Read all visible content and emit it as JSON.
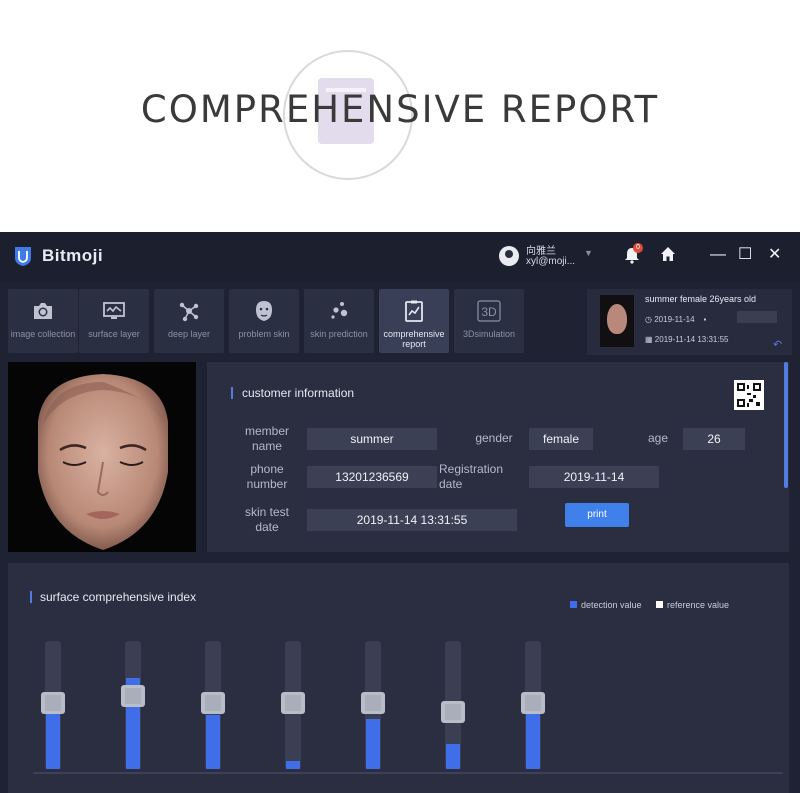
{
  "hero": {
    "title": "COMPREHENSIVE REPORT"
  },
  "app": {
    "title": "Bitmoji",
    "user": {
      "name": "向雅兰",
      "email": "xyl@moji...",
      "notifications": "0"
    },
    "window_controls": {
      "minimize": "—",
      "maximize": "☐",
      "close": "✕"
    }
  },
  "tabs": [
    {
      "label": "image collection",
      "icon": "camera-icon",
      "active": false
    },
    {
      "label": "surface layer",
      "icon": "monitor-wave-icon",
      "active": false
    },
    {
      "label": "deep layer",
      "icon": "molecule-icon",
      "active": false
    },
    {
      "label": "problem skin",
      "icon": "face-mask-icon",
      "active": false
    },
    {
      "label": "skin prediction",
      "icon": "dots-icon",
      "active": false
    },
    {
      "label": "comprehensive report",
      "icon": "report-chart-icon",
      "active": true
    },
    {
      "label": "3Dsimulation",
      "icon": "3d-icon",
      "active": false
    }
  ],
  "profile": {
    "line1": "summer   female   26years old",
    "date1": "2019-11-14",
    "datetime": "2019-11-14 13:31:55"
  },
  "customer_info": {
    "title": "customer information",
    "fields": {
      "member_name_label": "member name",
      "member_name": "summer",
      "gender_label": "gender",
      "gender": "female",
      "age_label": "age",
      "age": "26",
      "phone_label": "phone number",
      "phone": "13201236569",
      "registration_label": "Registration date",
      "registration": "2019-11-14",
      "skin_test_label": "skin test date",
      "skin_test": "2019-11-14 13:31:55"
    },
    "print_label": "print"
  },
  "index": {
    "title": "surface comprehensive index",
    "legend_detection": "detection value",
    "legend_reference": "reference value",
    "colors": {
      "detection": "#3f6ee8",
      "reference": "#ffffff"
    },
    "gauges": [
      {
        "detection_fraction": 0.5,
        "reference_fraction": 0.52
      },
      {
        "detection_fraction": 0.72,
        "reference_fraction": 0.58
      },
      {
        "detection_fraction": 0.43,
        "reference_fraction": 0.52
      },
      {
        "detection_fraction": 0.06,
        "reference_fraction": 0.52
      },
      {
        "detection_fraction": 0.4,
        "reference_fraction": 0.52
      },
      {
        "detection_fraction": 0.2,
        "reference_fraction": 0.45
      },
      {
        "detection_fraction": 0.58,
        "reference_fraction": 0.52
      }
    ]
  }
}
